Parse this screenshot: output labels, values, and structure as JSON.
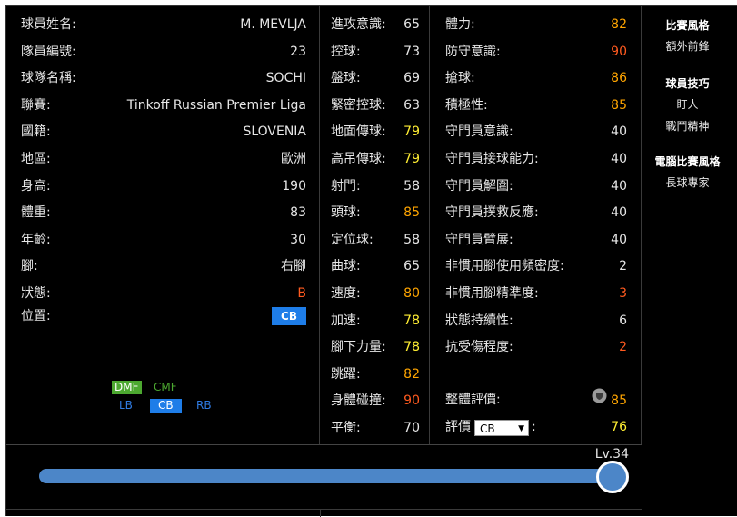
{
  "profile": {
    "rows": [
      {
        "label": "球員姓名:",
        "value": "M. MEVLJA",
        "color": "white"
      },
      {
        "label": "隊員編號:",
        "value": "23",
        "color": "white"
      },
      {
        "label": "球隊名稱:",
        "value": "SOCHI",
        "color": "white"
      },
      {
        "label": "聯賽:",
        "value": "Tinkoff Russian Premier Liga",
        "color": "white"
      },
      {
        "label": "國籍:",
        "value": "SLOVENIA",
        "color": "white"
      },
      {
        "label": "地區:",
        "value": "歐洲",
        "color": "white"
      },
      {
        "label": "身高:",
        "value": "190",
        "color": "white"
      },
      {
        "label": "體重:",
        "value": "83",
        "color": "white"
      },
      {
        "label": "年齡:",
        "value": "30",
        "color": "white"
      },
      {
        "label": "腳:",
        "value": "右腳",
        "color": "white"
      },
      {
        "label": "狀態:",
        "value": "B",
        "color": "red"
      }
    ],
    "position_label": "位置:",
    "position_value": "CB"
  },
  "position_map": {
    "row1": [
      {
        "text": "DMF",
        "style": "green-filled"
      },
      {
        "text": "CMF",
        "style": "green-text"
      }
    ],
    "row2": [
      {
        "text": "LB",
        "style": "blue-text"
      },
      {
        "text": "CB",
        "style": "blue-filled"
      },
      {
        "text": "RB",
        "style": "blue-text"
      }
    ]
  },
  "attributes_a": [
    {
      "label": "進攻意識:",
      "value": "65",
      "color": "white"
    },
    {
      "label": "控球:",
      "value": "73",
      "color": "white"
    },
    {
      "label": "盤球:",
      "value": "69",
      "color": "white"
    },
    {
      "label": "緊密控球:",
      "value": "63",
      "color": "white"
    },
    {
      "label": "地面傳球:",
      "value": "79",
      "color": "yellow"
    },
    {
      "label": "高吊傳球:",
      "value": "79",
      "color": "yellow"
    },
    {
      "label": "射門:",
      "value": "58",
      "color": "white"
    },
    {
      "label": "頭球:",
      "value": "85",
      "color": "orange"
    },
    {
      "label": "定位球:",
      "value": "58",
      "color": "white"
    },
    {
      "label": "曲球:",
      "value": "65",
      "color": "white"
    },
    {
      "label": "速度:",
      "value": "80",
      "color": "orange"
    },
    {
      "label": "加速:",
      "value": "78",
      "color": "yellow"
    },
    {
      "label": "腳下力量:",
      "value": "78",
      "color": "yellow"
    },
    {
      "label": "跳躍:",
      "value": "82",
      "color": "orange"
    },
    {
      "label": "身體碰撞:",
      "value": "90",
      "color": "red"
    },
    {
      "label": "平衡:",
      "value": "70",
      "color": "white"
    }
  ],
  "attributes_b": [
    {
      "label": "體力:",
      "value": "82",
      "color": "orange"
    },
    {
      "label": "防守意識:",
      "value": "90",
      "color": "red"
    },
    {
      "label": "搶球:",
      "value": "86",
      "color": "orange"
    },
    {
      "label": "積極性:",
      "value": "85",
      "color": "orange"
    },
    {
      "label": "守門員意識:",
      "value": "40",
      "color": "white"
    },
    {
      "label": "守門員接球能力:",
      "value": "40",
      "color": "white"
    },
    {
      "label": "守門員解圍:",
      "value": "40",
      "color": "white"
    },
    {
      "label": "守門員撲救反應:",
      "value": "40",
      "color": "white"
    },
    {
      "label": "守門員臂展:",
      "value": "40",
      "color": "white"
    },
    {
      "label": "非慣用腳使用頻密度:",
      "value": "2",
      "color": "white"
    },
    {
      "label": "非慣用腳精準度:",
      "value": "3",
      "color": "red"
    },
    {
      "label": "狀態持續性:",
      "value": "6",
      "color": "white"
    },
    {
      "label": "抗受傷程度:",
      "value": "2",
      "color": "red"
    }
  ],
  "overall": {
    "label": "整體評價:",
    "value": "85",
    "icon": "shield-badge-icon"
  },
  "rating": {
    "label": "評價",
    "selected": "CB",
    "value": "76",
    "suffix": ":"
  },
  "side": {
    "play_style_title": "比賽風格",
    "play_style": "額外前鋒",
    "skills_title": "球員技巧",
    "skills": [
      "盯人",
      "戰鬥精神"
    ],
    "ai_style_title": "電腦比賽風格",
    "ai_style": "長球專家"
  },
  "level": {
    "label": "Lv.34",
    "fraction": 1.0
  },
  "colors": {
    "white": "#e6e6e6",
    "yellow": "#ffee33",
    "orange": "#ffa500",
    "red": "#ff5a1f",
    "accent": "#1e7de8",
    "green": "#4ca830"
  }
}
